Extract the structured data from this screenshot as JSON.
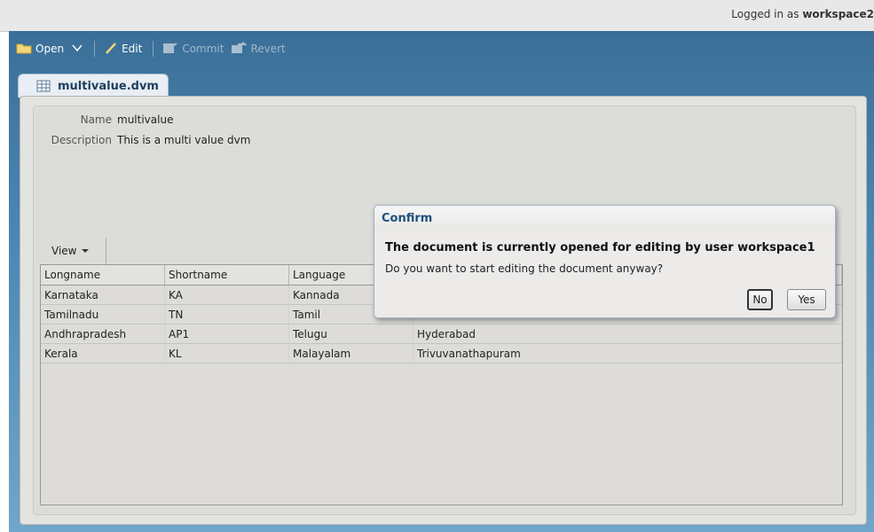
{
  "header": {
    "logged_prefix": "Logged in as ",
    "user": "workspace2"
  },
  "toolbar": {
    "open": "Open",
    "edit": "Edit",
    "commit": "Commit",
    "revert": "Revert"
  },
  "tab": {
    "label": "multivalue.dvm"
  },
  "document": {
    "name_label": "Name",
    "name_value": "multivalue",
    "description_label": "Description",
    "description_value": "This is a multi value dvm"
  },
  "view_menu": {
    "label": "View"
  },
  "table": {
    "columns": [
      "Longname",
      "Shortname",
      "Language",
      ""
    ],
    "rows": [
      [
        "Karnataka",
        "KA",
        "Kannada",
        ""
      ],
      [
        "Tamilnadu",
        "TN",
        "Tamil",
        ""
      ],
      [
        "Andhrapradesh",
        "AP1",
        "Telugu",
        "Hyderabad"
      ],
      [
        "Kerala",
        "KL",
        "Malayalam",
        "Trivuvanathapuram"
      ]
    ]
  },
  "dialog": {
    "title": "Confirm",
    "heading": "The document is currently opened for editing by user workspace1",
    "message": "Do you want to start editing the document anyway?",
    "no_label": "No",
    "yes_label": "Yes"
  },
  "colors": {
    "title_blue": "#1d4e7c",
    "frame_blue": "#4b86b3"
  },
  "icons": {
    "open": "folder-icon",
    "open_menu": "chevron-down-icon",
    "edit": "pencil-icon",
    "commit": "commit-icon",
    "revert": "revert-icon",
    "tab": "table-icon",
    "view_menu": "chevron-down-icon"
  }
}
